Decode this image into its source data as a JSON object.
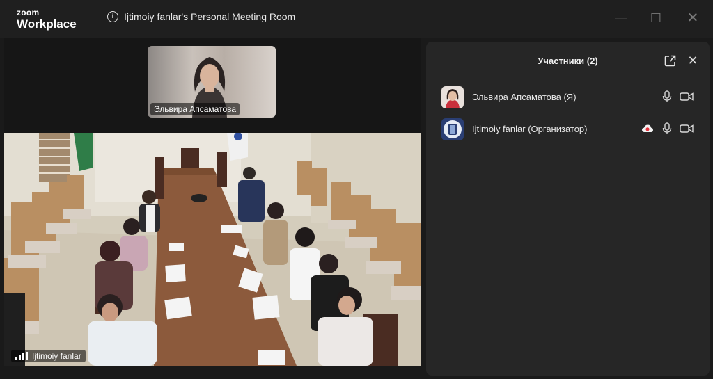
{
  "app": {
    "logo_line1": "zoom",
    "logo_line2": "Workplace"
  },
  "window": {
    "title": "Ijtimoiy fanlar's Personal Meeting Room"
  },
  "thumbnail": {
    "name": "Эльвира Апсаматова"
  },
  "main_video": {
    "name": "Ijtimoiy fanlar"
  },
  "participants": {
    "title": "Участники (2)",
    "items": [
      {
        "name": "Эльвира Апсаматова (Я)",
        "icons": [
          "mic-icon",
          "camera-icon"
        ]
      },
      {
        "name": "Ijtimoiy fanlar (Организатор)",
        "icons": [
          "cloud-recording-icon",
          "mic-icon",
          "camera-icon"
        ]
      }
    ]
  },
  "colors": {
    "titlebar": "#1f1f1f",
    "panel": "#262626",
    "background": "#1a1a1a",
    "recording": "#e5323c"
  }
}
